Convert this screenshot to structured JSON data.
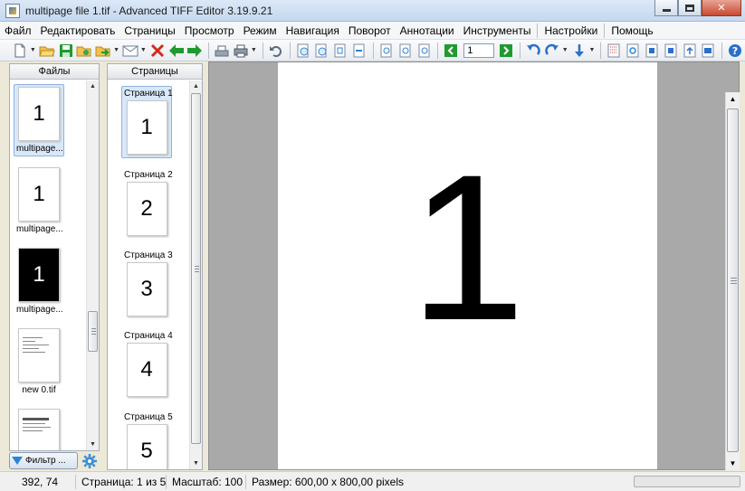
{
  "window": {
    "title": "multipage file 1.tif - Advanced TIFF Editor 3.19.9.21"
  },
  "menu": {
    "items": [
      "Файл",
      "Редактировать",
      "Страницы",
      "Просмотр",
      "Режим",
      "Навигация",
      "Поворот",
      "Аннотации",
      "Инструменты",
      "Настройки",
      "Помощь"
    ]
  },
  "toolbar": {
    "page_value": "1"
  },
  "files_pane": {
    "header": "Файлы",
    "items": [
      {
        "thumb": "1",
        "label": "multipage..."
      },
      {
        "thumb": "1",
        "label": "multipage..."
      },
      {
        "thumb": "1",
        "label": "multipage..."
      },
      {
        "thumb": "",
        "label": "new  0.tif"
      },
      {
        "thumb": "",
        "label": ""
      }
    ],
    "filter_label": "Фильтр ..."
  },
  "pages_pane": {
    "header": "Страницы",
    "items": [
      {
        "label": "Страница 1",
        "thumb": "1"
      },
      {
        "label": "Страница 2",
        "thumb": "2"
      },
      {
        "label": "Страница 3",
        "thumb": "3"
      },
      {
        "label": "Страница 4",
        "thumb": "4"
      },
      {
        "label": "Страница 5",
        "thumb": "5"
      }
    ]
  },
  "viewer": {
    "page_content": "1"
  },
  "statusbar": {
    "coords": "392, 74",
    "page": "Страница: 1 из 5",
    "scale": "Масштаб: 100",
    "size": "Размер: 600,00 x 800,00 pixels"
  },
  "colors": {
    "accent": "#2a85d6",
    "selection": "#d9e8f9",
    "nav_green": "#1f9a2f",
    "delete_red": "#d42a1d"
  }
}
